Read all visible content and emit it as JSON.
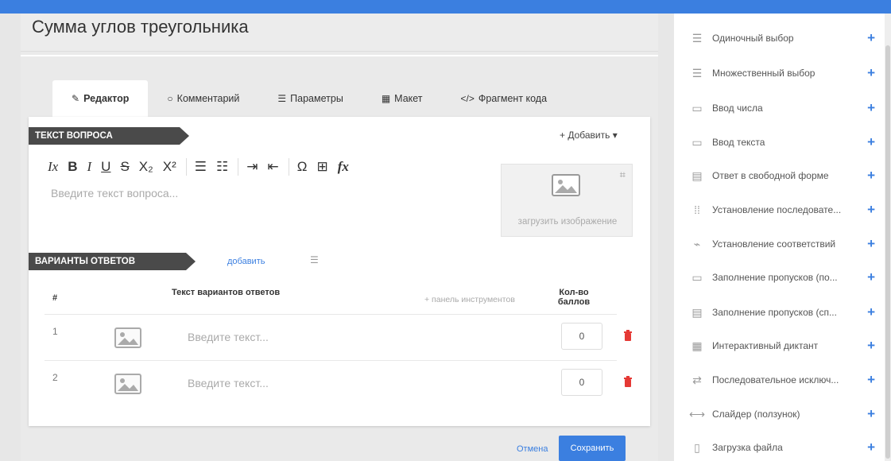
{
  "page_title": "Сумма углов треугольника",
  "tabs": [
    {
      "icon": "✎",
      "label": "Редактор"
    },
    {
      "icon": "○",
      "label": "Комментарий"
    },
    {
      "icon": "☰",
      "label": "Параметры"
    },
    {
      "icon": "▦",
      "label": "Макет"
    },
    {
      "icon": "</>",
      "label": "Фрагмент кода"
    }
  ],
  "question": {
    "section_label": "ТЕКСТ ВОПРОСА",
    "add_dropdown": "+ Добавить ▾",
    "placeholder": "Введите текст вопроса...",
    "upload_caption": "загрузить изображение",
    "toolbar": [
      "Ix",
      "B",
      "I",
      "U",
      "S",
      "X₂",
      "X²",
      "list-ordered",
      "list-bullet",
      "indent",
      "outdent",
      "Ω",
      "table",
      "fx"
    ]
  },
  "answers": {
    "section_label": "ВАРИАНТЫ ОТВЕТОВ",
    "add_link": "добавить",
    "columns": {
      "num": "#",
      "text": "Текст вариантов ответов",
      "toolbar_link": "+ панель инструментов",
      "points": "Кол-во баллов"
    },
    "rows": [
      {
        "index": "1",
        "placeholder": "Введите текст...",
        "score": "0"
      },
      {
        "index": "2",
        "placeholder": "Введите текст...",
        "score": "0"
      }
    ]
  },
  "footer": {
    "cancel": "Отмена",
    "save": "Сохранить"
  },
  "sidebar": [
    {
      "icon": "list-icon",
      "label": "Одиночный выбор"
    },
    {
      "icon": "list-icon",
      "label": "Множественный выбор"
    },
    {
      "icon": "input-icon",
      "label": "Ввод числа"
    },
    {
      "icon": "input-icon",
      "label": "Ввод текста"
    },
    {
      "icon": "textarea-icon",
      "label": "Ответ в свободной форме"
    },
    {
      "icon": "sequence-icon",
      "label": "Установление последовате..."
    },
    {
      "icon": "link-icon",
      "label": "Установление соответствий"
    },
    {
      "icon": "input-icon",
      "label": "Заполнение пропусков (по..."
    },
    {
      "icon": "dropdown-icon",
      "label": "Заполнение пропусков (сп..."
    },
    {
      "icon": "grid-icon",
      "label": "Интерактивный диктант"
    },
    {
      "icon": "exchange-icon",
      "label": "Последовательное исключ..."
    },
    {
      "icon": "slider-icon",
      "label": "Слайдер (ползунок)"
    },
    {
      "icon": "file-icon",
      "label": "Загрузка файла"
    }
  ],
  "colors": {
    "accent": "#3b7fe0",
    "ribbon": "#4a4a4a",
    "delete": "#e53935"
  }
}
